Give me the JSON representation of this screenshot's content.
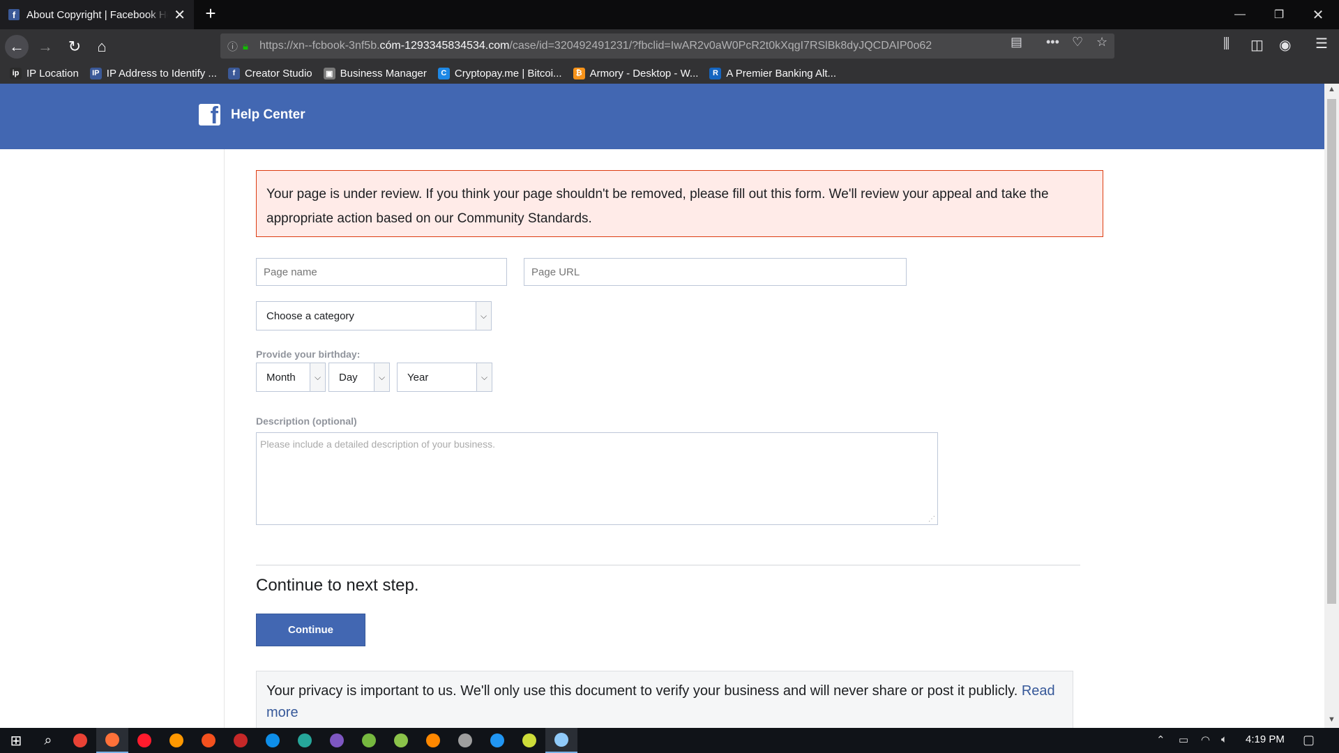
{
  "browser": {
    "tab_title": "About Copyright | Facebook Help Center",
    "url_prefix": "https://xn--fcbook-3nf5b.",
    "url_host": "cóm-1293345834534.com",
    "url_rest": "/case/id=320492491231/?fbclid=IwAR2v0aW0PcR2t0kXqgI7RSlBk8dyJQCDAIP0o62",
    "bookmarks": [
      {
        "label": "IP Location",
        "color": "#2b2b2b",
        "glyph": "ip"
      },
      {
        "label": "IP Address to Identify ...",
        "color": "#3b5998",
        "glyph": "IP"
      },
      {
        "label": "Creator Studio",
        "color": "#3b5998",
        "glyph": "f"
      },
      {
        "label": "Business Manager",
        "color": "#7a7a7a",
        "glyph": "▣"
      },
      {
        "label": "Cryptopay.me | Bitcoi...",
        "color": "#1e88e5",
        "glyph": "C"
      },
      {
        "label": "Armory - Desktop - W...",
        "color": "#f7931a",
        "glyph": "₿"
      },
      {
        "label": "A Premier Banking Alt...",
        "color": "#1565c0",
        "glyph": "R"
      }
    ]
  },
  "header": {
    "logo": "f",
    "title": "Help Center"
  },
  "alert": {
    "text": "Your page is under review. If you think your page shouldn't be removed, please fill out this form. We'll review your appeal and take the appropriate action based on our Community Standards."
  },
  "form": {
    "page_name_placeholder": "Page name",
    "page_url_placeholder": "Page URL",
    "category_selected": "Choose a category",
    "birthday_label": "Provide your birthday:",
    "month": "Month",
    "day": "Day",
    "year": "Year",
    "description_label": "Description (optional)",
    "description_placeholder": "Please include a detailed description of your business."
  },
  "next_step": {
    "title": "Continue to next step.",
    "button": "Continue"
  },
  "privacy": {
    "text": "Your privacy is important to us. We'll only use this document to verify your business and will never share or post it publicly. ",
    "link": "Read more"
  },
  "taskbar": {
    "time": "4:19 PM",
    "apps": [
      {
        "name": "chrome",
        "color": "#e94235"
      },
      {
        "name": "firefox",
        "color": "#ff7139",
        "active": true
      },
      {
        "name": "opera",
        "color": "#ff1b2d"
      },
      {
        "name": "sublime",
        "color": "#ff9800"
      },
      {
        "name": "app5",
        "color": "#f4511e"
      },
      {
        "name": "app6",
        "color": "#c62828"
      },
      {
        "name": "teamviewer",
        "color": "#0e8ee9"
      },
      {
        "name": "app8",
        "color": "#26a69a"
      },
      {
        "name": "app9",
        "color": "#7e57c2"
      },
      {
        "name": "utorrent",
        "color": "#76b83f"
      },
      {
        "name": "notepad-plus",
        "color": "#8bc34a"
      },
      {
        "name": "vlc",
        "color": "#ff8800"
      },
      {
        "name": "app13",
        "color": "#9e9e9e"
      },
      {
        "name": "app14",
        "color": "#2196f3"
      },
      {
        "name": "app15",
        "color": "#cddc39"
      },
      {
        "name": "app16",
        "color": "#90caf9",
        "active": true
      }
    ]
  }
}
